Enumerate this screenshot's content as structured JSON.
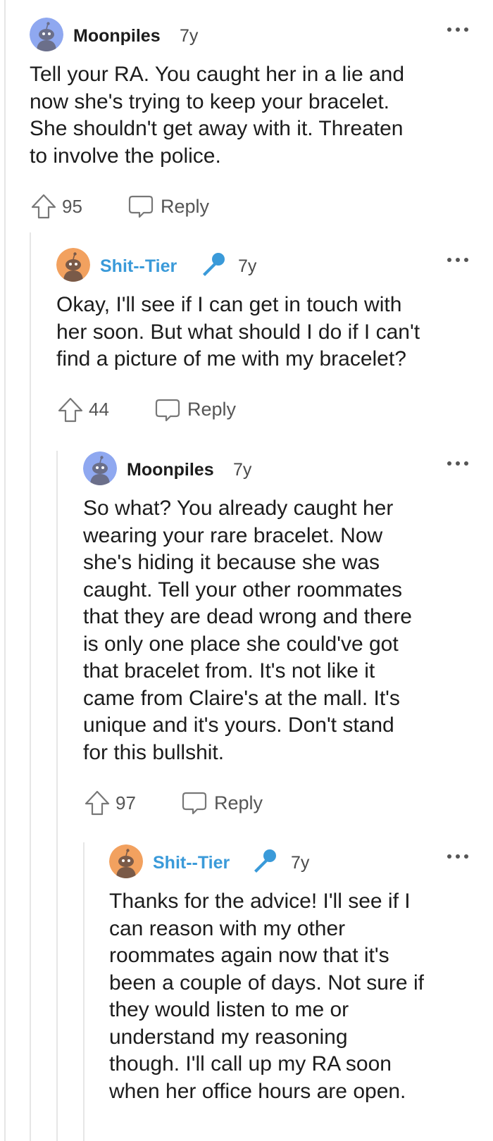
{
  "comments": [
    {
      "author": "Moonpiles",
      "age": "7y",
      "body_lines": [
        "Tell your RA. You caught her in a lie and",
        "now she's trying to keep your bracelet.",
        "She shouldn't get away with it. Threaten",
        "to involve the police."
      ],
      "votes": "95",
      "reply_label": "Reply"
    },
    {
      "author": "Shit--Tier",
      "age": "7y",
      "body_lines": [
        "Okay, I'll see if I can get in touch with",
        "her soon. But what should I do if I can't",
        "find a picture of me with my bracelet?"
      ],
      "votes": "44",
      "reply_label": "Reply"
    },
    {
      "author": "Moonpiles",
      "age": "7y",
      "body_lines": [
        "So what? You already caught her",
        "wearing your rare bracelet. Now",
        "she's hiding it because she was",
        "caught. Tell your other roommates",
        "that they are dead wrong and there",
        "is only one place she could've got",
        "that bracelet from. It's not like it",
        "came from Claire's at the mall. It's",
        "unique and it's yours. Don't stand",
        "for this bullshit."
      ],
      "votes": "97",
      "reply_label": "Reply"
    },
    {
      "author": "Shit--Tier",
      "age": "7y",
      "body_lines": [
        "Thanks for the advice! I'll see if I",
        "can reason with my other",
        "roommates again now that it's",
        "been a couple of days. Not sure if",
        "they would listen to me or",
        "understand my reasoning",
        "though. I'll call up my RA soon",
        "when her office hours are open."
      ]
    }
  ],
  "icons": {
    "avatar_default": "snoo-avatar-icon",
    "op_badge": "microphone-icon",
    "upvote": "upvote-arrow-icon",
    "reply": "speech-bubble-icon",
    "more": "more-options-icon"
  },
  "colors": {
    "op_username": "#3a9ad9",
    "avatar_blue": "#8fa8f0",
    "avatar_orange": "#f2a15f",
    "text": "#1c1c1c",
    "muted": "#555555",
    "thread_line": "#e6e6e6"
  }
}
